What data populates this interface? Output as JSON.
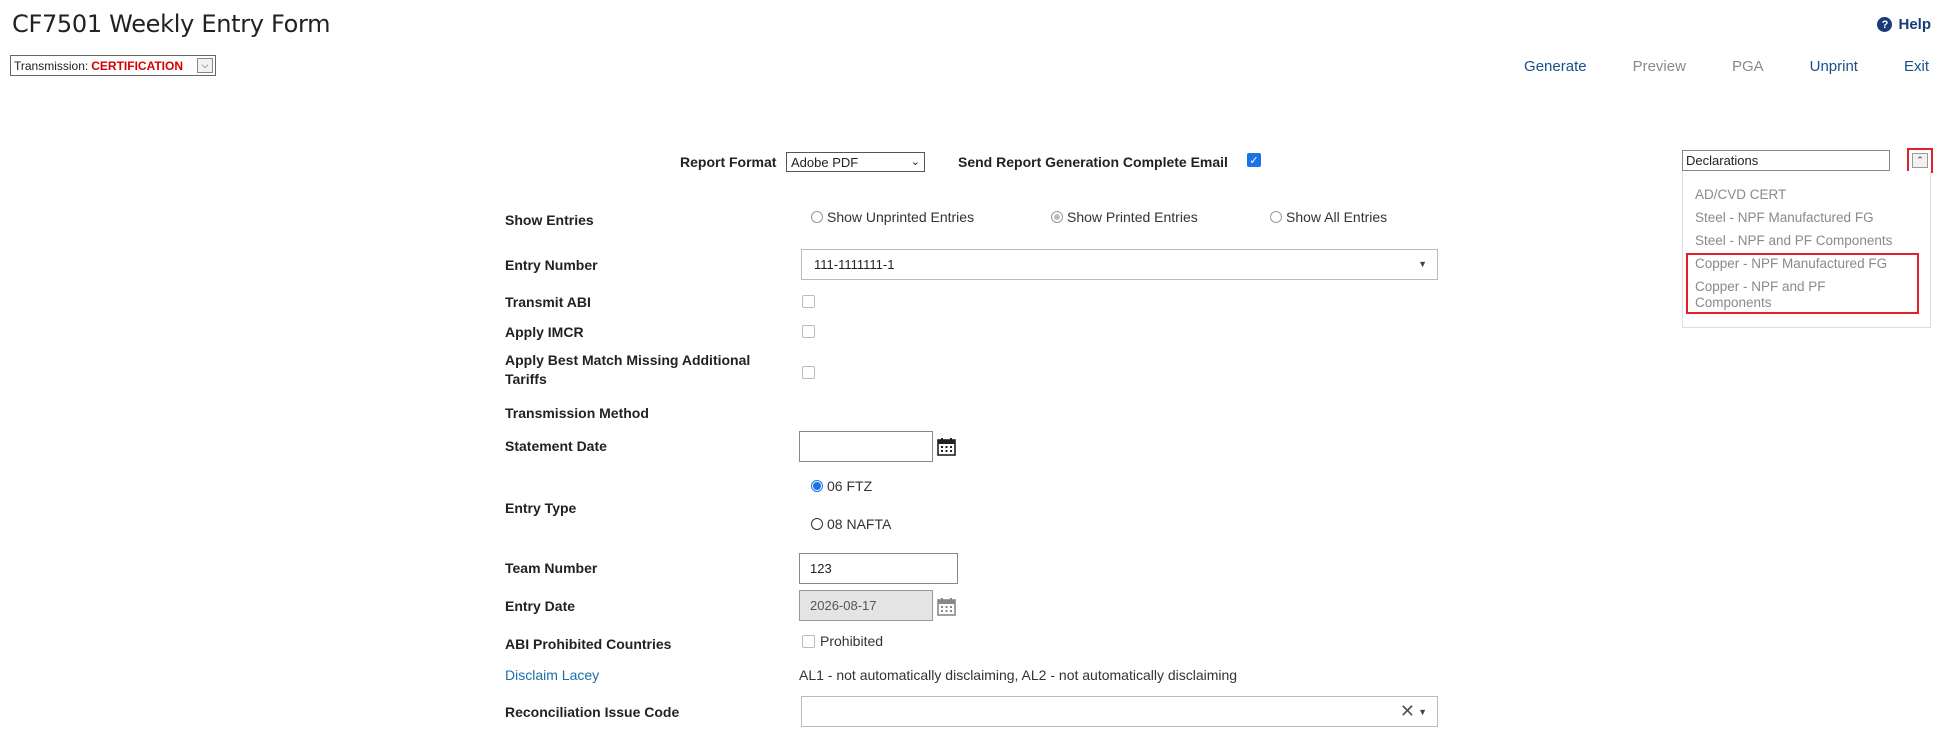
{
  "page": {
    "title": "CF7501 Weekly Entry Form",
    "help_label": "Help"
  },
  "transmission": {
    "label": "Transmission:",
    "value": "CERTIFICATION"
  },
  "actions": {
    "generate": "Generate",
    "preview": "Preview",
    "pga": "PGA",
    "unprint": "Unprint",
    "exit": "Exit"
  },
  "report": {
    "format_label": "Report Format",
    "format_value": "Adobe PDF",
    "email_label": "Send Report Generation Complete Email",
    "email_checked": true
  },
  "form": {
    "show_entries_label": "Show Entries",
    "show_entries_options": [
      "Show Unprinted Entries",
      "Show Printed Entries",
      "Show All Entries"
    ],
    "show_entries_selected": "Show Printed Entries",
    "entry_number_label": "Entry Number",
    "entry_number_value": "111-1111111-1",
    "transmit_abi_label": "Transmit ABI",
    "apply_imcr_label": "Apply IMCR",
    "apply_best_match_label_1": "Apply Best Match Missing Additional",
    "apply_best_match_label_2": "Tariffs",
    "transmission_method_label": "Transmission Method",
    "statement_date_label": "Statement Date",
    "statement_date_value": "",
    "entry_type_label": "Entry Type",
    "entry_type_options": [
      "06 FTZ",
      "08 NAFTA"
    ],
    "entry_type_selected": "06 FTZ",
    "team_number_label": "Team Number",
    "team_number_value": "123",
    "entry_date_label": "Entry Date",
    "entry_date_value": "2026-08-17",
    "abi_prohibited_label": "ABI Prohibited Countries",
    "prohibited_option": "Prohibited",
    "disclaim_lacey_label": "Disclaim Lacey",
    "disclaim_lacey_value": "AL1 - not automatically disclaiming, AL2 - not automatically disclaiming",
    "recon_issue_label": "Reconciliation Issue Code",
    "recon_issue_value": ""
  },
  "declarations": {
    "header": "Declarations",
    "items": [
      "AD/CVD CERT",
      "Steel - NPF Manufactured FG",
      "Steel - NPF and PF Components",
      "Copper - NPF Manufactured FG",
      "Copper - NPF and PF",
      "Components"
    ]
  },
  "colors": {
    "accent_blue": "#1a73e8",
    "link_blue": "#1a4f8a",
    "highlight_red": "#e0202a",
    "cert_red": "#d40000"
  }
}
